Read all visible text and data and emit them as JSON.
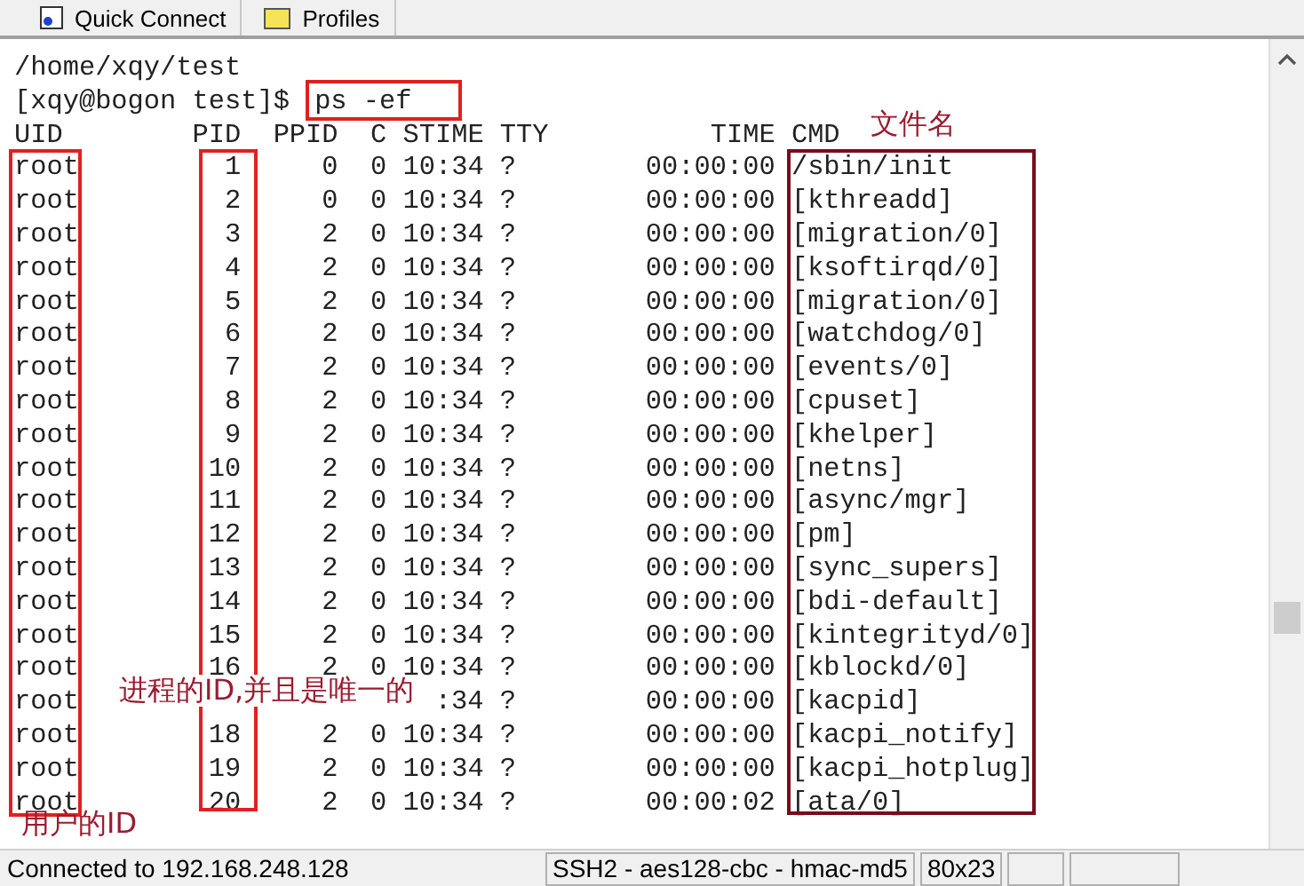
{
  "toolbar": {
    "buttons": [
      "Quick Connect",
      "Profiles"
    ]
  },
  "terminal": {
    "lines": [
      "/home/xqy/test"
    ],
    "prompt": "[xqy@bogon test]$",
    "command": "ps -ef",
    "header": {
      "uid": "UID",
      "pid": "PID",
      "ppid": "PPID",
      "c": "C",
      "stime": "STIME",
      "tty": "TTY",
      "time": "TIME",
      "cmd": "CMD"
    },
    "processes": [
      {
        "uid": "root",
        "pid": "1",
        "ppid": "0",
        "c": "0",
        "stime": "10:34",
        "tty": "?",
        "time": "00:00:00",
        "cmd": "/sbin/init"
      },
      {
        "uid": "root",
        "pid": "2",
        "ppid": "0",
        "c": "0",
        "stime": "10:34",
        "tty": "?",
        "time": "00:00:00",
        "cmd": "[kthreadd]"
      },
      {
        "uid": "root",
        "pid": "3",
        "ppid": "2",
        "c": "0",
        "stime": "10:34",
        "tty": "?",
        "time": "00:00:00",
        "cmd": "[migration/0]"
      },
      {
        "uid": "root",
        "pid": "4",
        "ppid": "2",
        "c": "0",
        "stime": "10:34",
        "tty": "?",
        "time": "00:00:00",
        "cmd": "[ksoftirqd/0]"
      },
      {
        "uid": "root",
        "pid": "5",
        "ppid": "2",
        "c": "0",
        "stime": "10:34",
        "tty": "?",
        "time": "00:00:00",
        "cmd": "[migration/0]"
      },
      {
        "uid": "root",
        "pid": "6",
        "ppid": "2",
        "c": "0",
        "stime": "10:34",
        "tty": "?",
        "time": "00:00:00",
        "cmd": "[watchdog/0]"
      },
      {
        "uid": "root",
        "pid": "7",
        "ppid": "2",
        "c": "0",
        "stime": "10:34",
        "tty": "?",
        "time": "00:00:00",
        "cmd": "[events/0]"
      },
      {
        "uid": "root",
        "pid": "8",
        "ppid": "2",
        "c": "0",
        "stime": "10:34",
        "tty": "?",
        "time": "00:00:00",
        "cmd": "[cpuset]"
      },
      {
        "uid": "root",
        "pid": "9",
        "ppid": "2",
        "c": "0",
        "stime": "10:34",
        "tty": "?",
        "time": "00:00:00",
        "cmd": "[khelper]"
      },
      {
        "uid": "root",
        "pid": "10",
        "ppid": "2",
        "c": "0",
        "stime": "10:34",
        "tty": "?",
        "time": "00:00:00",
        "cmd": "[netns]"
      },
      {
        "uid": "root",
        "pid": "11",
        "ppid": "2",
        "c": "0",
        "stime": "10:34",
        "tty": "?",
        "time": "00:00:00",
        "cmd": "[async/mgr]"
      },
      {
        "uid": "root",
        "pid": "12",
        "ppid": "2",
        "c": "0",
        "stime": "10:34",
        "tty": "?",
        "time": "00:00:00",
        "cmd": "[pm]"
      },
      {
        "uid": "root",
        "pid": "13",
        "ppid": "2",
        "c": "0",
        "stime": "10:34",
        "tty": "?",
        "time": "00:00:00",
        "cmd": "[sync_supers]"
      },
      {
        "uid": "root",
        "pid": "14",
        "ppid": "2",
        "c": "0",
        "stime": "10:34",
        "tty": "?",
        "time": "00:00:00",
        "cmd": "[bdi-default]"
      },
      {
        "uid": "root",
        "pid": "15",
        "ppid": "2",
        "c": "0",
        "stime": "10:34",
        "tty": "?",
        "time": "00:00:00",
        "cmd": "[kintegrityd/0]"
      },
      {
        "uid": "root",
        "pid": "16",
        "ppid": "2",
        "c": "0",
        "stime": "10:34",
        "tty": "?",
        "time": "00:00:00",
        "cmd": "[kblockd/0]"
      },
      {
        "uid": "root",
        "stime": ":34",
        "tty": "?",
        "time": "00:00:00",
        "cmd": "[kacpid]"
      },
      {
        "uid": "root",
        "pid": "18",
        "ppid": "2",
        "c": "0",
        "stime": "10:34",
        "tty": "?",
        "time": "00:00:00",
        "cmd": "[kacpi_notify]"
      },
      {
        "uid": "root",
        "pid": "19",
        "ppid": "2",
        "c": "0",
        "stime": "10:34",
        "tty": "?",
        "time": "00:00:00",
        "cmd": "[kacpi_hotplug]"
      },
      {
        "uid": "root",
        "pid": "20",
        "ppid": "2",
        "c": "0",
        "stime": "10:34",
        "tty": "?",
        "time": "00:00:02",
        "cmd": "[ata/0]"
      }
    ]
  },
  "annotations": [
    "文件名",
    "进程的ID,并且是唯一的",
    "用户的ID"
  ],
  "status_bar": [
    "Connected to 192.168.248.128",
    "SSH2 - aes128-cbc - hmac-md5",
    "80x23"
  ]
}
